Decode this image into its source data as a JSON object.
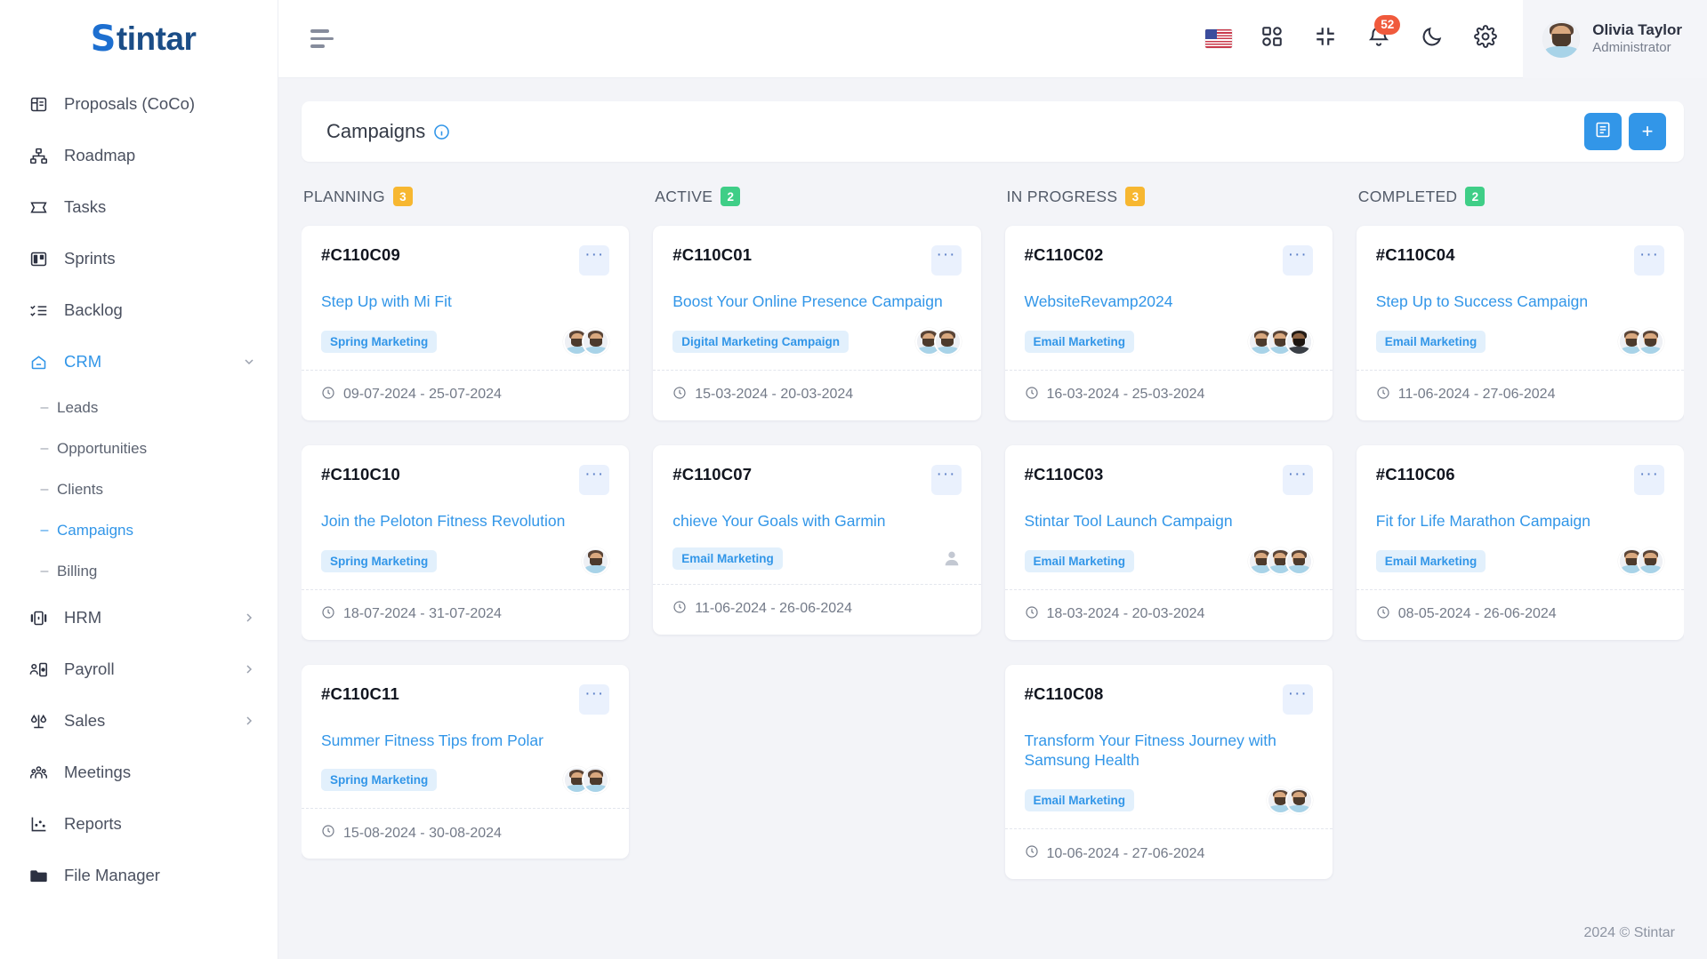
{
  "brand": {
    "prefix": "S",
    "rest": "tintar"
  },
  "sidebar": {
    "items": [
      {
        "label": "Proposals (CoCo)",
        "icon": "proposals-icon",
        "active": false,
        "chevron": false
      },
      {
        "label": "Roadmap",
        "icon": "roadmap-icon",
        "active": false,
        "chevron": false
      },
      {
        "label": "Tasks",
        "icon": "tasks-icon",
        "active": false,
        "chevron": false
      },
      {
        "label": "Sprints",
        "icon": "sprints-icon",
        "active": false,
        "chevron": false
      },
      {
        "label": "Backlog",
        "icon": "backlog-icon",
        "active": false,
        "chevron": false
      },
      {
        "label": "CRM",
        "icon": "crm-icon",
        "active": true,
        "chevron": "down"
      },
      {
        "label": "HRM",
        "icon": "hrm-icon",
        "active": false,
        "chevron": "right"
      },
      {
        "label": "Payroll",
        "icon": "payroll-icon",
        "active": false,
        "chevron": "right"
      },
      {
        "label": "Sales",
        "icon": "sales-icon",
        "active": false,
        "chevron": "right"
      },
      {
        "label": "Meetings",
        "icon": "meetings-icon",
        "active": false,
        "chevron": false
      },
      {
        "label": "Reports",
        "icon": "reports-icon",
        "active": false,
        "chevron": false
      },
      {
        "label": "File Manager",
        "icon": "folder-icon",
        "active": false,
        "chevron": false
      }
    ],
    "crm_children": [
      {
        "label": "Leads",
        "active": false
      },
      {
        "label": "Opportunities",
        "active": false
      },
      {
        "label": "Clients",
        "active": false
      },
      {
        "label": "Campaigns",
        "active": true
      },
      {
        "label": "Billing",
        "active": false
      }
    ]
  },
  "topbar": {
    "language_flag": "us-flag-icon",
    "apps_icon": "grid-apps-icon",
    "fullscreen_icon": "collapse-fullscreen-icon",
    "notifications_icon": "bell-icon",
    "notifications_count": "52",
    "theme_icon": "moon-icon",
    "settings_icon": "gear-icon",
    "profile": {
      "name": "Olivia Taylor",
      "role": "Administrator"
    }
  },
  "page": {
    "title": "Campaigns",
    "info_icon": "info-circle-icon",
    "list_view_button": "list-view-icon",
    "add_button": "+"
  },
  "board": {
    "columns": [
      {
        "title": "PLANNING",
        "count": "3",
        "count_color": "#f7b731",
        "cards": [
          {
            "code": "#C110C09",
            "title": "Step Up with Mi Fit",
            "tag": "Spring Marketing",
            "dates": "09-07-2024 - 25-07-2024",
            "avatars": [
              "light",
              "light"
            ]
          },
          {
            "code": "#C110C10",
            "title": "Join the Peloton Fitness Revolution",
            "tag": "Spring Marketing",
            "dates": "18-07-2024 - 31-07-2024",
            "avatars": [
              "light"
            ]
          },
          {
            "code": "#C110C11",
            "title": "Summer Fitness Tips from Polar",
            "tag": "Spring Marketing",
            "dates": "15-08-2024 - 30-08-2024",
            "avatars": [
              "light",
              "light"
            ]
          }
        ]
      },
      {
        "title": "ACTIVE",
        "count": "2",
        "count_color": "#3fce87",
        "cards": [
          {
            "code": "#C110C01",
            "title": "Boost Your Online Presence Campaign",
            "tag": "Digital Marketing Campaign",
            "dates": "15-03-2024 - 20-03-2024",
            "avatars": [
              "light",
              "light"
            ]
          },
          {
            "code": "#C110C07",
            "title": "chieve Your Goals with Garmin",
            "tag": "Email Marketing",
            "dates": "11-06-2024 - 26-06-2024",
            "avatars": [
              "placeholder"
            ]
          }
        ]
      },
      {
        "title": "IN PROGRESS",
        "count": "3",
        "count_color": "#f7b731",
        "cards": [
          {
            "code": "#C110C02",
            "title": "WebsiteRevamp2024",
            "tag": "Email Marketing",
            "dates": "16-03-2024 - 25-03-2024",
            "avatars": [
              "light",
              "light",
              "dark"
            ]
          },
          {
            "code": "#C110C03",
            "title": "Stintar Tool Launch Campaign",
            "tag": "Email Marketing",
            "dates": "18-03-2024 - 20-03-2024",
            "avatars": [
              "light",
              "light",
              "light"
            ]
          },
          {
            "code": "#C110C08",
            "title": "Transform Your Fitness Journey with Samsung Health",
            "tag": "Email Marketing",
            "dates": "10-06-2024 - 27-06-2024",
            "avatars": [
              "light",
              "light"
            ]
          }
        ]
      },
      {
        "title": "COMPLETED",
        "count": "2",
        "count_color": "#3fce87",
        "cards": [
          {
            "code": "#C110C04",
            "title": "Step Up to Success Campaign",
            "tag": "Email Marketing",
            "dates": "11-06-2024 - 27-06-2024",
            "avatars": [
              "light",
              "light"
            ]
          },
          {
            "code": "#C110C06",
            "title": "Fit for Life Marathon Campaign",
            "tag": "Email Marketing",
            "dates": "08-05-2024 - 26-06-2024",
            "avatars": [
              "light",
              "light"
            ]
          }
        ]
      }
    ]
  },
  "footer": {
    "copyright": "2024 © Stintar"
  },
  "colors": {
    "accent": "#3296e8",
    "warning": "#f7b731",
    "success": "#3fce87",
    "danger": "#f05a3c"
  }
}
